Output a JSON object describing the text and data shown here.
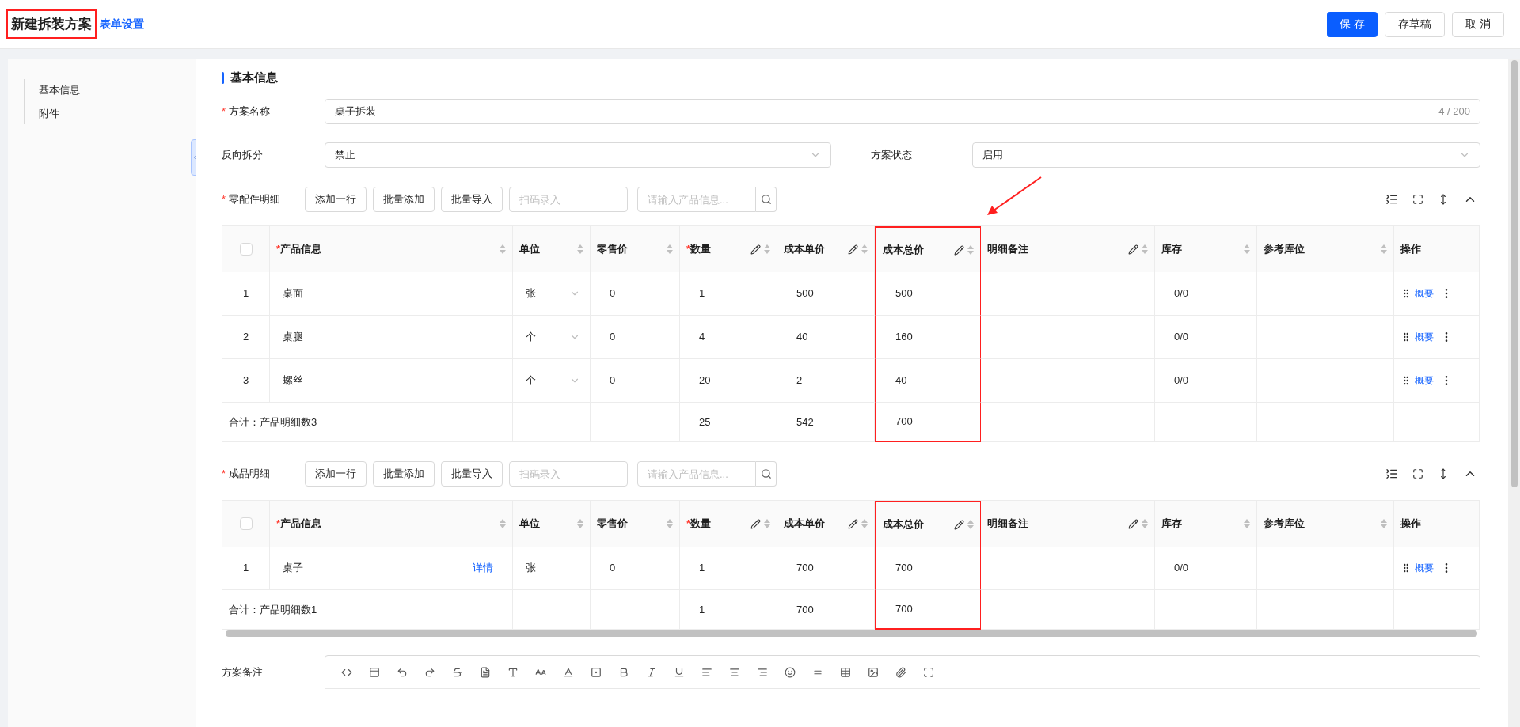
{
  "header": {
    "title": "新建拆装方案",
    "title_highlighted": true,
    "settings_link": "表单设置",
    "buttons": [
      {
        "label": "保 存",
        "kind": "primary"
      },
      {
        "label": "存草稿",
        "kind": "default"
      },
      {
        "label": "取 消",
        "kind": "default"
      }
    ]
  },
  "sidebar": {
    "items": [
      {
        "label": "基本信息"
      },
      {
        "label": "附件"
      }
    ]
  },
  "section": {
    "title": "基本信息"
  },
  "name_field": {
    "label": "方案名称",
    "required_mark": "*",
    "value": "桌子拆装",
    "counter": "4 / 200"
  },
  "reverse_split": {
    "label": "反向拆分",
    "value": "禁止"
  },
  "status": {
    "label": "方案状态",
    "value": "启用"
  },
  "annotation_arrow": true,
  "tables": [
    {
      "label": "零配件明细",
      "required_mark": "*",
      "buttons": [
        "添加一行",
        "批量添加",
        "批量导入"
      ],
      "scan_placeholder": "扫码录入",
      "search_placeholder": "请输入产品信息...",
      "scrollbar": false,
      "columns": [
        {
          "kind": "select",
          "checked": false
        },
        {
          "kind": "product",
          "title": "产品信息",
          "required_mark": "*",
          "editable": false,
          "sortable": true,
          "highlighted": false
        },
        {
          "kind": "unit",
          "title": "单位",
          "editable": false,
          "sortable": true,
          "highlighted": false
        },
        {
          "kind": "retail_price",
          "title": "零售价",
          "editable": false,
          "sortable": true,
          "highlighted": false
        },
        {
          "kind": "quantity",
          "title": "数量",
          "required_mark": "*",
          "editable": true,
          "sortable": true,
          "highlighted": false
        },
        {
          "kind": "unit_cost",
          "title": "成本单价",
          "editable": true,
          "sortable": true,
          "highlighted": false
        },
        {
          "kind": "total_cost",
          "title": "成本总价",
          "editable": true,
          "sortable": true,
          "highlighted": true
        },
        {
          "kind": "note",
          "title": "明细备注",
          "editable": true,
          "sortable": true,
          "highlighted": false
        },
        {
          "kind": "stock",
          "title": "库存",
          "editable": false,
          "sortable": true,
          "highlighted": false
        },
        {
          "kind": "location",
          "title": "参考库位",
          "editable": false,
          "sortable": true,
          "highlighted": false
        },
        {
          "kind": "actions",
          "title": "操作",
          "editable": false,
          "sortable": false,
          "highlighted": false
        }
      ],
      "rows": [
        {
          "index": "1",
          "product": "桌面",
          "unit": "张",
          "unit_dropdown": true,
          "retail_price": "0",
          "quantity": "1",
          "unit_cost": "500",
          "total_cost": "500",
          "stock": "0/0",
          "action_link": "概要"
        },
        {
          "index": "2",
          "product": "桌腿",
          "unit": "个",
          "unit_dropdown": true,
          "retail_price": "0",
          "quantity": "4",
          "unit_cost": "40",
          "total_cost": "160",
          "stock": "0/0",
          "action_link": "概要"
        },
        {
          "index": "3",
          "product": "螺丝",
          "unit": "个",
          "unit_dropdown": true,
          "retail_price": "0",
          "quantity": "20",
          "unit_cost": "2",
          "total_cost": "40",
          "stock": "0/0",
          "action_link": "概要"
        }
      ],
      "total": {
        "label": "合计：产品明细数3",
        "quantity": "25",
        "unit_cost": "542",
        "total_cost": "700"
      }
    },
    {
      "label": "成品明细",
      "required_mark": "*",
      "buttons": [
        "添加一行",
        "批量添加",
        "批量导入"
      ],
      "scan_placeholder": "扫码录入",
      "search_placeholder": "请输入产品信息...",
      "scrollbar": true,
      "columns": [
        {
          "kind": "select",
          "checked": false
        },
        {
          "kind": "product",
          "title": "产品信息",
          "required_mark": "*",
          "editable": false,
          "sortable": true,
          "highlighted": false
        },
        {
          "kind": "unit",
          "title": "单位",
          "editable": false,
          "sortable": true,
          "highlighted": false
        },
        {
          "kind": "retail_price",
          "title": "零售价",
          "editable": false,
          "sortable": true,
          "highlighted": false
        },
        {
          "kind": "quantity",
          "title": "数量",
          "required_mark": "*",
          "editable": true,
          "sortable": true,
          "highlighted": false
        },
        {
          "kind": "unit_cost",
          "title": "成本单价",
          "editable": true,
          "sortable": true,
          "highlighted": false
        },
        {
          "kind": "total_cost",
          "title": "成本总价",
          "editable": true,
          "sortable": true,
          "highlighted": true
        },
        {
          "kind": "note",
          "title": "明细备注",
          "editable": true,
          "sortable": true,
          "highlighted": false
        },
        {
          "kind": "stock",
          "title": "库存",
          "editable": false,
          "sortable": true,
          "highlighted": false
        },
        {
          "kind": "location",
          "title": "参考库位",
          "editable": false,
          "sortable": true,
          "highlighted": false
        },
        {
          "kind": "actions",
          "title": "操作",
          "editable": false,
          "sortable": false,
          "highlighted": false
        }
      ],
      "rows": [
        {
          "index": "1",
          "product": "桌子",
          "detail_link": "详情",
          "unit": "张",
          "unit_dropdown": false,
          "retail_price": "0",
          "quantity": "1",
          "unit_cost": "700",
          "total_cost": "700",
          "stock": "0/0",
          "action_link": "概要"
        }
      ],
      "total": {
        "label": "合计：产品明细数1",
        "quantity": "1",
        "unit_cost": "700",
        "total_cost": "700"
      }
    }
  ],
  "remarks": {
    "label": "方案备注"
  }
}
